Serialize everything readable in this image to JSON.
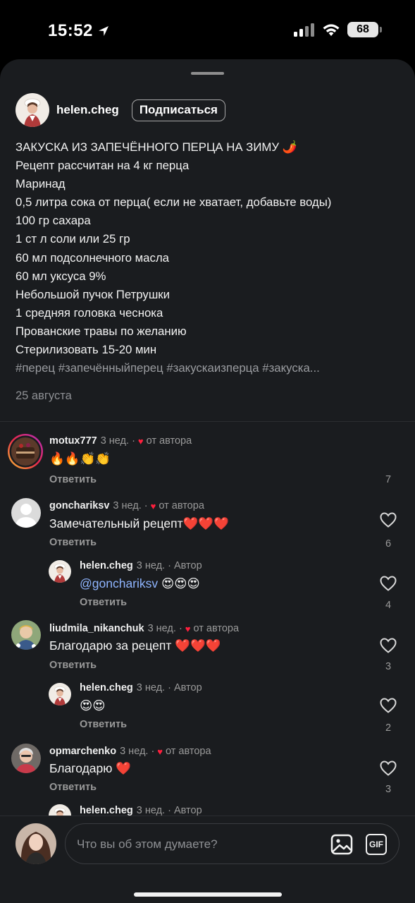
{
  "status_bar": {
    "time": "15:52",
    "battery": "68"
  },
  "post": {
    "username": "helen.cheg",
    "follow_label": "Подписаться",
    "caption_lines": [
      "ЗАКУСКА ИЗ ЗАПЕЧЁННОГО ПЕРЦА НА ЗИМУ 🌶️",
      "Рецепт рассчитан на 4 кг перца",
      "Маринад",
      "0,5 литра сока от перца( если не хватает, добавьте воды)",
      "100 гр сахара",
      "1 ст л соли или 25 гр",
      "60 мл подсолнечного масла",
      "60 мл уксуса 9%",
      "Небольшой пучок Петрушки",
      "1 средняя головка чеснока",
      "Прованские травы по желанию",
      "Стерилизовать 15-20 мин"
    ],
    "hashtags": "#перец #запечённыйперец #закускаизперца #закуска...",
    "date": "25 августа"
  },
  "comments": [
    {
      "username": "motux777",
      "age": "3 нед.",
      "tag": "от автора",
      "text": "🔥🔥👏👏",
      "reply_label": "Ответить",
      "likes": "7"
    },
    {
      "username": "gonchariksv",
      "age": "3 нед.",
      "tag": "от автора",
      "text": "Замечательный рецепт❤️❤️❤️",
      "reply_label": "Ответить",
      "likes": "6"
    },
    {
      "username": "helen.cheg",
      "age": "3 нед.",
      "tag": "Автор",
      "mention": "@gonchariksv",
      "text": " 😍😍😍",
      "reply_label": "Ответить",
      "likes": "4"
    },
    {
      "username": "liudmila_nikanchuk",
      "age": "3 нед.",
      "tag": "от автора",
      "text": "Благодарю за рецепт ❤️❤️❤️",
      "reply_label": "Ответить",
      "likes": "3"
    },
    {
      "username": "helen.cheg",
      "age": "3 нед.",
      "tag": "Автор",
      "text": "😍😍",
      "reply_label": "Ответить",
      "likes": "2"
    },
    {
      "username": "opmarchenko",
      "age": "3 нед.",
      "tag": "от автора",
      "text": "Благодарю ❤️",
      "reply_label": "Ответить",
      "likes": "3"
    },
    {
      "username": "helen.cheg",
      "age": "3 нед.",
      "tag": "Автор"
    }
  ],
  "composer": {
    "placeholder": "Что вы об этом думаете?",
    "gif_label": "GIF"
  },
  "colors": {
    "background": "#1a1c1f",
    "like_heart": "#ff1f3d",
    "mention": "#8fb5ff",
    "secondary_text": "#9a9a9a"
  }
}
